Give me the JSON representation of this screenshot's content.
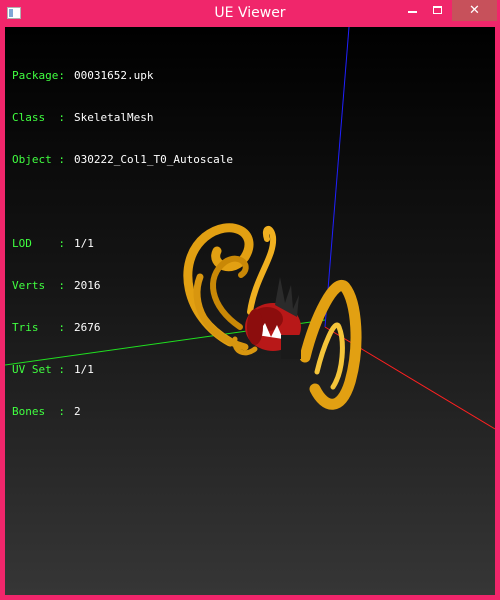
{
  "window": {
    "title": "UE Viewer",
    "icons": {
      "app": "app-window-icon",
      "minimize": "minimize-icon",
      "maximize": "maximize-icon",
      "close": "close-icon"
    },
    "close_glyph": "✕"
  },
  "info": {
    "package": {
      "label": "Package:",
      "value": "00031652.upk"
    },
    "class": {
      "label": "Class  :",
      "value": "SkeletalMesh"
    },
    "object": {
      "label": "Object :",
      "value": "030222_Col1_T0_Autoscale"
    },
    "lod": {
      "label": "LOD    :",
      "value": "1/1"
    },
    "verts": {
      "label": "Verts  :",
      "value": "2016"
    },
    "tris": {
      "label": "Tris   :",
      "value": "2676"
    },
    "uvset": {
      "label": "UV Set :",
      "value": "1/1"
    },
    "bones": {
      "label": "Bones  :",
      "value": "2"
    }
  },
  "colors": {
    "frame": "#f0266b",
    "close_button": "#c7515b",
    "label_green": "#40ff40",
    "axis_x": "#ff2020",
    "axis_y": "#20e020",
    "axis_z": "#2020ff",
    "mesh_gold": "#e2a012",
    "mesh_red": "#b81818"
  }
}
